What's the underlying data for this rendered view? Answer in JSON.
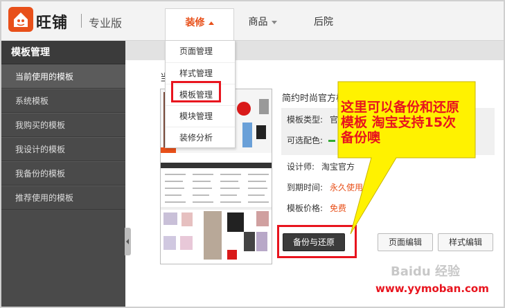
{
  "header": {
    "brand": "旺铺",
    "edition": "专业版",
    "nav": {
      "decorate": "装修",
      "goods": "商品",
      "backyard": "后院"
    }
  },
  "dropdown": {
    "items": [
      "页面管理",
      "样式管理",
      "模板管理",
      "模块管理",
      "装修分析"
    ]
  },
  "sidebar": {
    "title": "模板管理",
    "items": [
      "当前使用的模板",
      "系统模板",
      "我购买的模板",
      "我设计的模板",
      "我备份的模板",
      "推荐使用的模板"
    ]
  },
  "main": {
    "section_title": "当",
    "template_name": "简约时尚官方模板",
    "type_label": "模板类型:",
    "type_value": "官",
    "color_label": "可选配色:",
    "designer_label": "设计师:",
    "designer_value": "淘宝官方",
    "expiry_label": "到期时间:",
    "expiry_value": "永久使用",
    "price_label": "模板价格:",
    "price_value": "免费",
    "buttons": {
      "backup": "备份与还原",
      "page_edit": "页面编辑",
      "style_edit": "样式编辑"
    }
  },
  "callout": {
    "text": "这里可以备份和还原模板  淘宝支持15次备份噢"
  },
  "watermark": {
    "logo": "Baidu 经验",
    "url": "www.yymoban.com"
  },
  "colors": {
    "accent": "#e8501a",
    "highlight_red": "#e8141e",
    "sidebar_bg": "#4a4a4a",
    "callout_yellow": "#fff200"
  }
}
